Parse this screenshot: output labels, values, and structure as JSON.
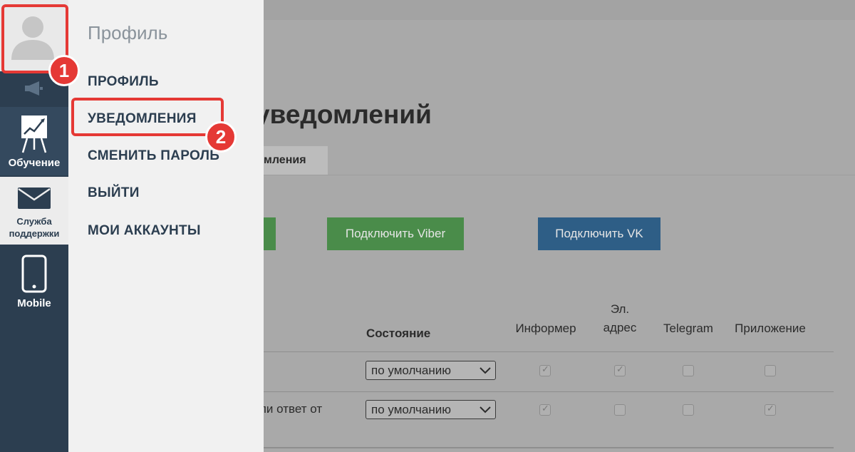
{
  "sidebar": {
    "training_label": "Обучение",
    "support_label": "Служба поддержки",
    "mobile_label": "Mobile"
  },
  "profile_menu": {
    "title": "Профиль",
    "items": [
      {
        "label": "ПРОФИЛЬ"
      },
      {
        "label": "УВЕДОМЛЕНИЯ"
      },
      {
        "label": "СМЕНИТЬ ПАРОЛЬ"
      },
      {
        "label": "ВЫЙТИ"
      },
      {
        "label": "МОИ АККАУНТЫ"
      }
    ]
  },
  "callouts": {
    "first": "1",
    "second": "2"
  },
  "main": {
    "title_fragment": "уведомлений",
    "tab_fragment": "мления",
    "buttons": {
      "viber": "Подключить Viber",
      "vk": "Подключить VK"
    },
    "table": {
      "headers": {
        "state": "Состояние",
        "informer": "Информер",
        "email": "Эл. адрес",
        "telegram": "Telegram",
        "app": "Приложение"
      },
      "rows": [
        {
          "text": "",
          "state": "по умолчанию",
          "informer": true,
          "email": true,
          "telegram": false,
          "app": false
        },
        {
          "text": "ли ответ от",
          "state": "по умолчанию",
          "informer": true,
          "email": false,
          "telegram": false,
          "app": true
        }
      ]
    }
  },
  "colors": {
    "sidebar_bg": "#2c3e50",
    "callout_red": "#e53935",
    "viber_green": "#4a8c4a",
    "vk_blue": "#2e5e86"
  }
}
